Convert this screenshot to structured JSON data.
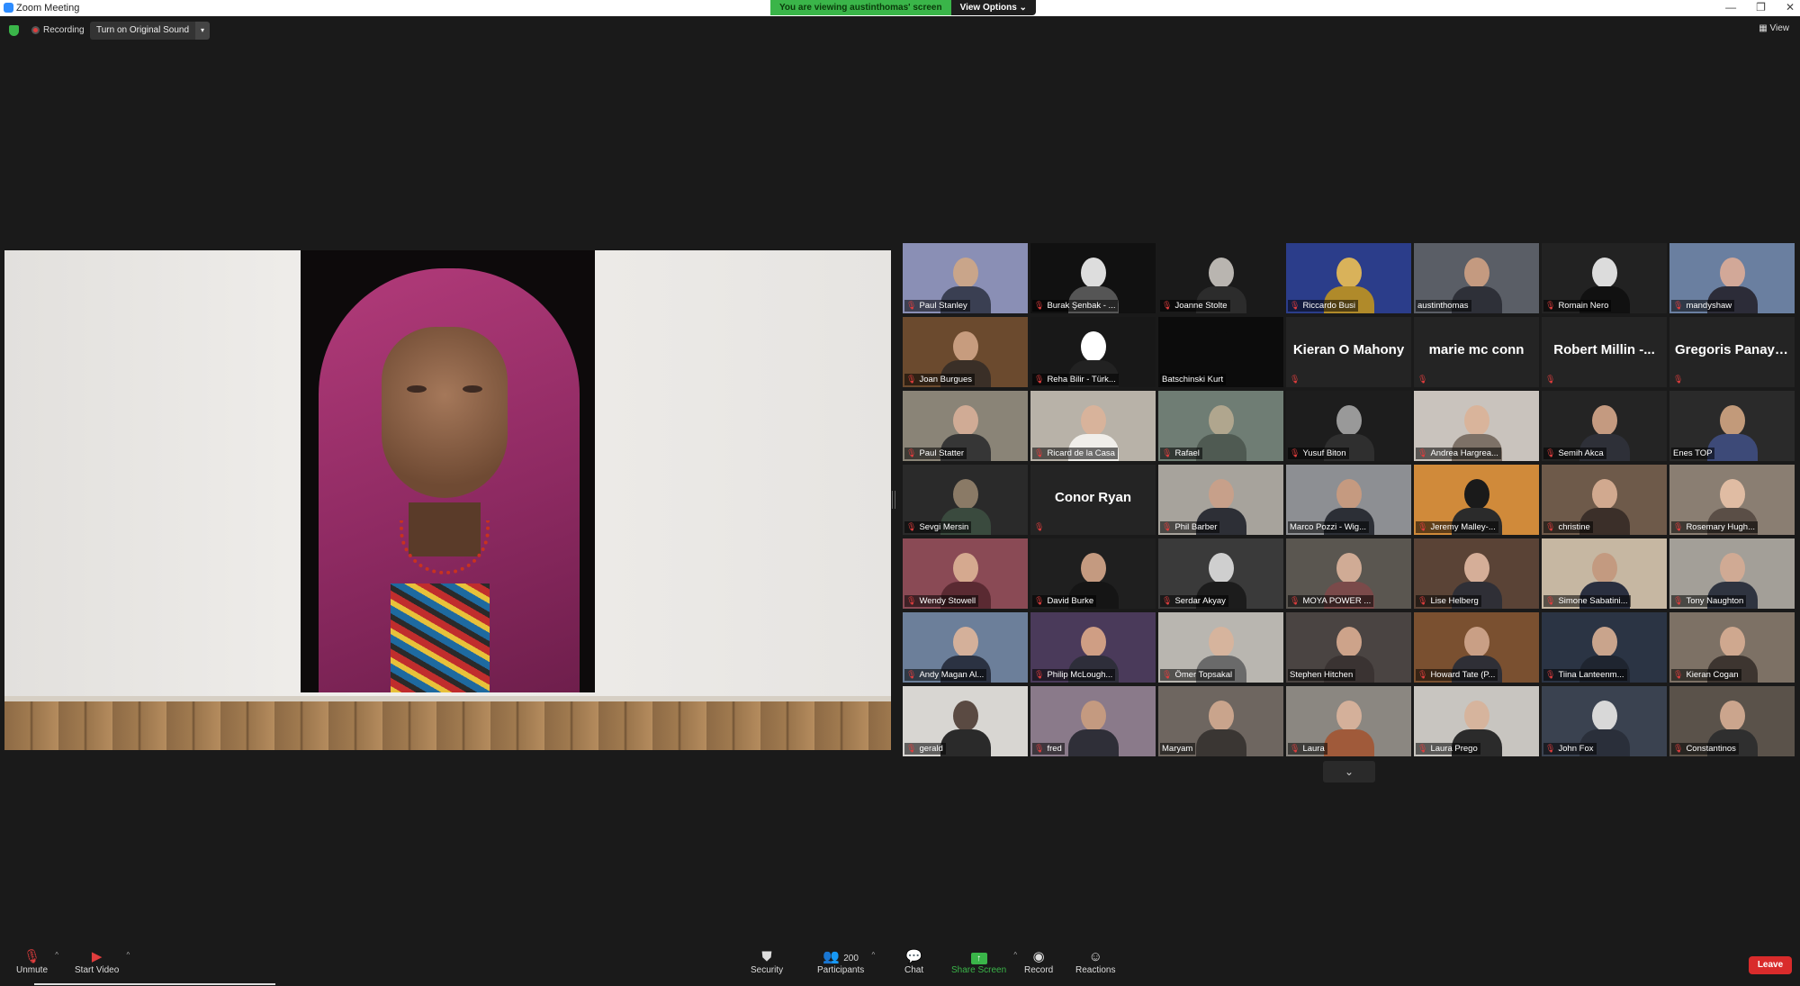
{
  "window": {
    "title": "Zoom Meeting",
    "controls": [
      "—",
      "❐",
      "✕"
    ]
  },
  "banner": {
    "message": "You are viewing austinthomas' screen",
    "view_options": "View Options ⌄"
  },
  "top_bar": {
    "recording": "Recording",
    "original_sound": "Turn on Original Sound",
    "dropdown": "▾",
    "view": "View"
  },
  "gallery": [
    {
      "name": "Paul Stanley",
      "muted": true,
      "bg": "#8a8fb5",
      "head": "#c9a58a",
      "body": "#3a3f52"
    },
    {
      "name": "Burak Şenbak - ...",
      "muted": true,
      "bg": "#111111",
      "head": "#dddddd",
      "body": "#555555"
    },
    {
      "name": "Joanne Stolte",
      "muted": true,
      "bg": "#1a1a1a",
      "head": "#b9b5b0",
      "body": "#2c2c2c"
    },
    {
      "name": "Riccardo Busi",
      "muted": true,
      "bg": "#2b3d8a",
      "head": "#d9b25a",
      "body": "#b08a2a"
    },
    {
      "name": "austinthomas",
      "muted": false,
      "bg": "#5a5e66",
      "head": "#c49a80",
      "body": "#2e3038"
    },
    {
      "name": "Romain Nero",
      "muted": true,
      "bg": "#222222",
      "head": "#dcdcdc",
      "body": "#111111"
    },
    {
      "name": "mandyshaw",
      "muted": true,
      "bg": "#6a7fa0",
      "head": "#d2a898",
      "body": "#2c2c38"
    },
    {
      "name": "Joan Burgues",
      "muted": true,
      "bg": "#6b4a2e",
      "head": "#c79c7e",
      "body": "#3a2f27"
    },
    {
      "name": "Reha Bilir - Türk...",
      "muted": true,
      "bg": "#181818",
      "head": "#ffffff",
      "body": "#222222"
    },
    {
      "name": "Batschinski Kurt",
      "muted": false,
      "bg": "#0c0c0c",
      "head": "#0c0c0c",
      "body": "#0c0c0c"
    },
    {
      "name": "",
      "big": "Kieran O Mahony",
      "muted": true
    },
    {
      "name": "",
      "big": "marie mc conn",
      "muted": true
    },
    {
      "name": "",
      "big": "Robert Millin -...",
      "muted": true
    },
    {
      "name": "",
      "big": "Gregoris Panayi...",
      "muted": true
    },
    {
      "name": "Paul Statter",
      "muted": true,
      "bg": "#8a8477",
      "head": "#d0ab95",
      "body": "#363636"
    },
    {
      "name": "Ricard de la Casa",
      "muted": true,
      "bg": "#b8b2a8",
      "head": "#d8b39b",
      "body": "#f0eeea"
    },
    {
      "name": "Rafael",
      "muted": true,
      "bg": "#6f7d74",
      "head": "#b0a68e",
      "body": "#4f5a52"
    },
    {
      "name": "Yusuf Biton",
      "muted": true,
      "bg": "#1d1d1d",
      "head": "#999999",
      "body": "#2f2f2f"
    },
    {
      "name": "Andrea Hargrea...",
      "muted": true,
      "bg": "#c9c3bd",
      "head": "#d9b49b",
      "body": "#7d7167"
    },
    {
      "name": "Semih Akca",
      "muted": true,
      "bg": "#242424",
      "head": "#c49a80",
      "body": "#2e3038"
    },
    {
      "name": "Enes TOP",
      "muted": false,
      "bg": "#2a2a2a",
      "head": "#c29a7a",
      "body": "#3d4a78"
    },
    {
      "name": "Sevgi Mersin",
      "muted": true,
      "bg": "#2a2a2a",
      "head": "#8a7a66",
      "body": "#3a4a3e"
    },
    {
      "name": "",
      "big": "Conor Ryan",
      "muted": true
    },
    {
      "name": "Phil Barber",
      "muted": true,
      "bg": "#a7a39c",
      "head": "#c7a08a",
      "body": "#2d2f36"
    },
    {
      "name": "Marco Pozzi - Wig...",
      "muted": false,
      "active": true,
      "bg": "#8d8f93",
      "head": "#c59a80",
      "body": "#2c2f36"
    },
    {
      "name": "Jeremy Malley-...",
      "muted": true,
      "bg": "#d08a3a",
      "head": "#1a1a1a",
      "body": "#2b2b2b"
    },
    {
      "name": "christine",
      "muted": true,
      "bg": "#6e5a4a",
      "head": "#d1a98f",
      "body": "#3b2f29"
    },
    {
      "name": "Rosemary Hugh...",
      "muted": true,
      "bg": "#8a7e72",
      "head": "#e0bca3",
      "body": "#5a4e46"
    },
    {
      "name": "Wendy Stowell",
      "muted": true,
      "bg": "#8a4a55",
      "head": "#d5a98f",
      "body": "#5a2a32"
    },
    {
      "name": "David Burke",
      "muted": true,
      "bg": "#1f1f1f",
      "head": "#c49a80",
      "body": "#151515"
    },
    {
      "name": "Serdar Akyay",
      "muted": true,
      "bg": "#3a3a3a",
      "head": "#cfcfcf",
      "body": "#1c1c1c"
    },
    {
      "name": "MOYA POWER ...",
      "muted": true,
      "bg": "#5a5650",
      "head": "#d0ab95",
      "body": "#7a4a4a"
    },
    {
      "name": "Lise Helberg",
      "muted": true,
      "bg": "#5a4336",
      "head": "#d5ae98",
      "body": "#2f2f36"
    },
    {
      "name": "Simone Sabatini...",
      "muted": true,
      "bg": "#c6b7a2",
      "head": "#c39a80",
      "body": "#2a2f3f"
    },
    {
      "name": "Tony Naughton",
      "muted": true,
      "bg": "#a39f98",
      "head": "#d0aa94",
      "body": "#2f3440"
    },
    {
      "name": "Andy Magan Al...",
      "muted": true,
      "bg": "#6c7f9a",
      "head": "#d4b09a",
      "body": "#2b3242"
    },
    {
      "name": "Philip McLough...",
      "muted": true,
      "bg": "#4a3a5a",
      "head": "#cf9e84",
      "body": "#2e2e3a"
    },
    {
      "name": "Ömer Topsakal",
      "muted": true,
      "bg": "#b9b6b0",
      "head": "#d6b49d",
      "body": "#6a6a6a"
    },
    {
      "name": "Stephen Hitchen",
      "muted": false,
      "bg": "#4a4442",
      "head": "#cda38a",
      "body": "#3a3332"
    },
    {
      "name": "Howard Tate (P...",
      "muted": true,
      "bg": "#7a5030",
      "head": "#c99f85",
      "body": "#2f2f36"
    },
    {
      "name": "Tiina Lanteenm...",
      "muted": true,
      "bg": "#2b3444",
      "head": "#c9a48c",
      "body": "#1f2530"
    },
    {
      "name": "Kieran Cogan",
      "muted": true,
      "bg": "#7d7165",
      "head": "#cfa88f",
      "body": "#3d3530"
    },
    {
      "name": "gerald",
      "muted": true,
      "bg": "#d8d6d2",
      "head": "#5a4a42",
      "body": "#2a2a2a"
    },
    {
      "name": "fred",
      "muted": true,
      "bg": "#8a7a8a",
      "head": "#c49a80",
      "body": "#2f2f38"
    },
    {
      "name": "Maryam",
      "muted": false,
      "bg": "#6e6660",
      "head": "#c9a48c",
      "body": "#3a3633"
    },
    {
      "name": "Laura",
      "muted": true,
      "bg": "#8b8781",
      "head": "#d4b09a",
      "body": "#a05a3a"
    },
    {
      "name": "Laura Prego",
      "muted": true,
      "bg": "#c8c5c0",
      "head": "#d6b49d",
      "body": "#2b2b2b"
    },
    {
      "name": "John Fox",
      "muted": true,
      "bg": "#3a4250",
      "head": "#d8d8d8",
      "body": "#2a2f3a"
    },
    {
      "name": "Constantinos",
      "muted": true,
      "bg": "#5a524a",
      "head": "#cba58d",
      "body": "#2f2f2f"
    }
  ],
  "toolbar": {
    "unmute": "Unmute",
    "start_video": "Start Video",
    "security": "Security",
    "participants": "Participants",
    "participant_count": "200",
    "chat": "Chat",
    "share_screen": "Share Screen",
    "record": "Record",
    "reactions": "Reactions",
    "leave": "Leave"
  },
  "colors": {
    "accent_green": "#3ab549",
    "leave_red": "#d92b2b",
    "active_speaker": "#c5e34a",
    "mute_red": "#e03d3d"
  }
}
